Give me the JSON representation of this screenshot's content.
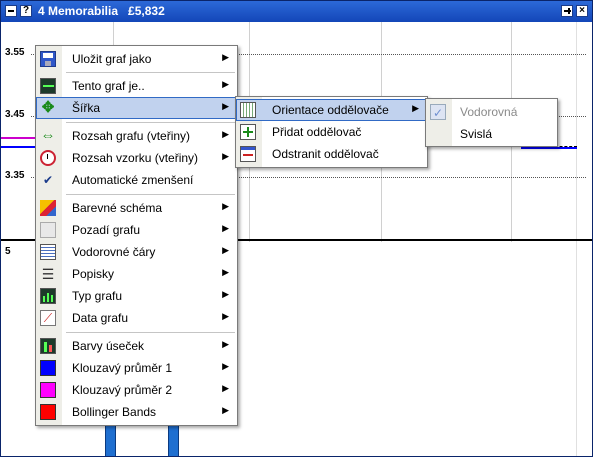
{
  "window": {
    "title": "4 Memorabilia",
    "price": "£5,832",
    "help_glyph": "?",
    "close_glyph": "×"
  },
  "chart": {
    "y_ticks": [
      "3.55",
      "3.45",
      "3.35"
    ],
    "volume_label": "5"
  },
  "main_menu": {
    "items": [
      {
        "label": "Uložit graf jako",
        "icon": "floppy-disk-icon",
        "submenu": true
      },
      {
        "label": "Tento graf je..",
        "icon": "chart-monitor-icon",
        "submenu": true
      },
      {
        "label": "Šířka",
        "icon": "width-arrows-icon",
        "submenu": true,
        "highlighted": true
      },
      {
        "label": "Rozsah grafu (vteřiny)",
        "icon": "horizontal-arrows-icon",
        "submenu": true
      },
      {
        "label": "Rozsah vzorku (vteřiny)",
        "icon": "stopwatch-icon",
        "submenu": true
      },
      {
        "label": "Automatické zmenšení",
        "icon": "checkmark-icon",
        "checked": true
      },
      {
        "label": "Barevné schéma",
        "icon": "paint-bucket-icon",
        "submenu": true
      },
      {
        "label": "Pozadí grafu",
        "icon": "background-icon",
        "submenu": true
      },
      {
        "label": "Vodorovné čáry",
        "icon": "horizontal-lines-icon",
        "submenu": true
      },
      {
        "label": "Popisky",
        "icon": "labels-list-icon",
        "submenu": true
      },
      {
        "label": "Typ grafu",
        "icon": "chart-type-icon",
        "submenu": true
      },
      {
        "label": "Data grafu",
        "icon": "chart-data-icon",
        "submenu": true
      },
      {
        "label": "Barvy úseček",
        "icon": "bar-colors-icon",
        "submenu": true
      },
      {
        "label": "Klouzavý průměr 1",
        "icon": "blue-swatch-icon",
        "color": "#0000ff",
        "submenu": true
      },
      {
        "label": "Klouzavý průměr 2",
        "icon": "magenta-swatch-icon",
        "color": "#ff00ff",
        "submenu": true
      },
      {
        "label": "Bollinger Bands",
        "icon": "red-swatch-icon",
        "color": "#ff0000",
        "submenu": true
      }
    ]
  },
  "width_submenu": {
    "items": [
      {
        "label": "Orientace oddělovače",
        "icon": "divider-orientation-icon",
        "submenu": true,
        "highlighted": true
      },
      {
        "label": "Přidat oddělovač",
        "icon": "add-divider-icon"
      },
      {
        "label": "Odstranit oddělovač",
        "icon": "remove-divider-icon"
      }
    ]
  },
  "orientation_submenu": {
    "items": [
      {
        "label": "Vodorovná",
        "checked": true,
        "disabled": true
      },
      {
        "label": "Svislá"
      }
    ]
  },
  "colors": {
    "titlebar": "#1a52c4",
    "highlight": "#c1d2ee",
    "highlight_border": "#316ac5",
    "volume_bars": "#1f6fd0",
    "ma2_line": "#cc00cc",
    "ma1_line": "#0000ff"
  }
}
